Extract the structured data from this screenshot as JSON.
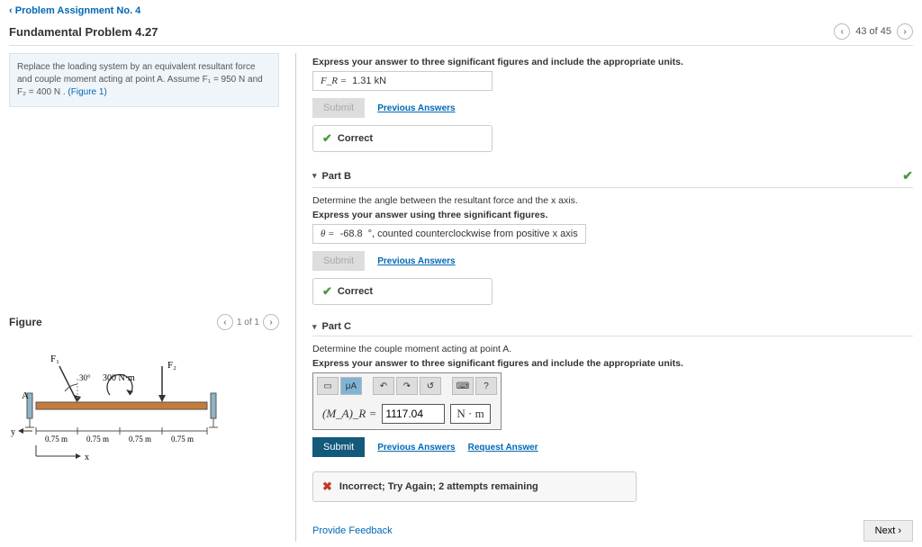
{
  "breadcrumb": "Problem Assignment No. 4",
  "title": "Fundamental Problem 4.27",
  "nav": {
    "pos": "43 of 45"
  },
  "prompt": {
    "text": "Replace the loading system by an equivalent resultant force and couple moment acting at point A. Assume F₁ = 950 N and F₂ = 400 N .",
    "figlink": "(Figure 1)"
  },
  "figure": {
    "label": "Figure",
    "pos": "1 of 1"
  },
  "beam": {
    "F1": "F₁",
    "F2": "F₂",
    "angle": "30°",
    "moment": "300 N·m",
    "dim": "0.75 m",
    "A": "A",
    "y": "y",
    "x": "x"
  },
  "partA": {
    "instr": "Express your answer to three significant figures and include the appropriate units.",
    "sym": "F_R =",
    "val": "1.31 kN",
    "submit": "Submit",
    "prev": "Previous Answers",
    "fb": "Correct"
  },
  "partB": {
    "hdr": "Part B",
    "q": "Determine the angle between the resultant force and the x axis.",
    "instr": "Express your answer using three significant figures.",
    "sym": "θ =",
    "val": "-68.8",
    "unit": "°, counted counterclockwise from positive x axis",
    "submit": "Submit",
    "prev": "Previous Answers",
    "fb": "Correct"
  },
  "partC": {
    "hdr": "Part C",
    "q": "Determine the couple moment acting at point A.",
    "instr": "Express your answer to three significant figures and include the appropriate units.",
    "sym": "(M_A)_R =",
    "val": "1117.04",
    "unit": "N · m",
    "submit": "Submit",
    "prev": "Previous Answers",
    "req": "Request Answer",
    "fb": "Incorrect; Try Again; 2 attempts remaining"
  },
  "footer": {
    "feedback": "Provide Feedback",
    "next": "Next ›"
  }
}
